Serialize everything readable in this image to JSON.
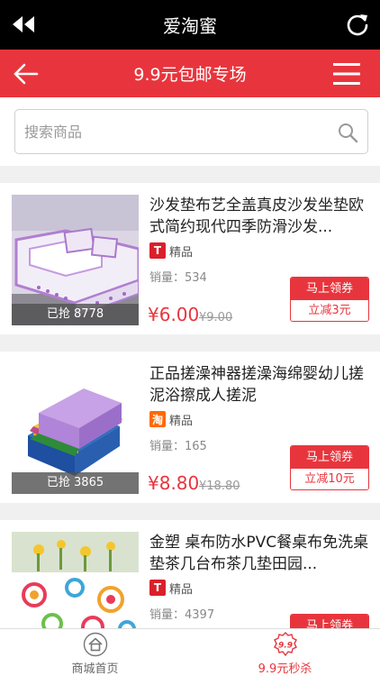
{
  "app": {
    "title": "爱淘蜜"
  },
  "nav": {
    "title": "9.9元包邮专场"
  },
  "search": {
    "placeholder": "搜索商品"
  },
  "products": [
    {
      "name": "沙发垫布艺全盖真皮沙发坐垫欧式简约现代四季防滑沙发...",
      "badge": "T",
      "tag": "精品",
      "sales_label": "销量：",
      "sales": "534",
      "grabbed": "已抢 8778",
      "price": "¥6.00",
      "orig_price": "¥9.00",
      "coupon_top": "马上领券",
      "coupon_bottom": "立减3元"
    },
    {
      "name": "正品搓澡神器搓澡海绵婴幼儿搓泥浴擦成人搓泥",
      "badge": "淘",
      "tag": "精品",
      "sales_label": "销量：",
      "sales": "165",
      "grabbed": "已抢 3865",
      "price": "¥8.80",
      "orig_price": "¥18.80",
      "coupon_top": "马上领券",
      "coupon_bottom": "立减10元"
    },
    {
      "name": "金塑 桌布防水PVC餐桌布免洗桌垫茶几台布茶几垫田园...",
      "badge": "T",
      "tag": "精品",
      "sales_label": "销量：",
      "sales": "4397",
      "grabbed": "",
      "price": "",
      "orig_price": "",
      "coupon_top": "马上领券",
      "coupon_bottom": ""
    }
  ],
  "tabs": [
    {
      "label": "商城首页",
      "icon": "home-icon",
      "active": false
    },
    {
      "label": "9.9元秒杀",
      "icon": "seckill-badge-icon",
      "badge_text": "9.9",
      "active": true
    }
  ],
  "colors": {
    "accent": "#e8353d",
    "topbar": "#000000",
    "tmall": "#d9202b",
    "taobao": "#ff6a00",
    "tab_inactive": "#666666"
  }
}
